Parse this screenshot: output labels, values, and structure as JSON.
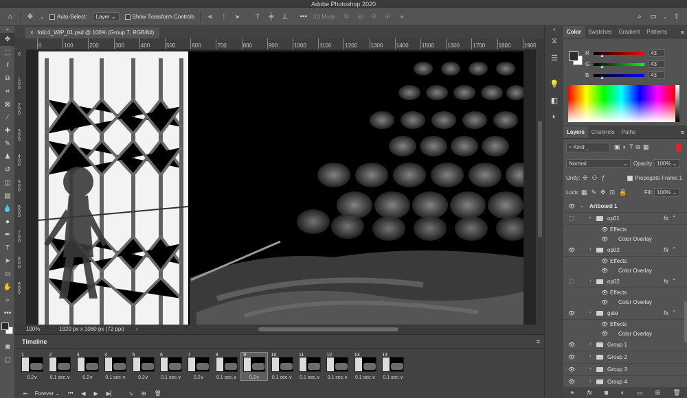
{
  "app": {
    "title": "Adobe Photoshop 2020"
  },
  "options_bar": {
    "auto_select_label": "Auto-Select:",
    "auto_select_checked": false,
    "auto_select_target": "Layer",
    "show_transform_label": "Show Transform Controls",
    "mode_3d_label": "3D Mode:"
  },
  "document": {
    "tab_title": "folio1_WIP_01.psd @ 100% (Group 7, RGB/8#)",
    "zoom": "100%",
    "doc_info": "1920 px x 1080 px (72 ppi)"
  },
  "ruler": {
    "h_ticks": [
      "0",
      "100",
      "200",
      "300",
      "400",
      "500",
      "600",
      "700",
      "800",
      "900",
      "1000",
      "1100",
      "1200",
      "1300",
      "1400",
      "1500",
      "1600",
      "1700",
      "1800",
      "1900"
    ],
    "v_ticks": [
      "0",
      "1\n0\n0",
      "2\n0\n0",
      "3\n0\n0",
      "4\n0\n0",
      "5\n0\n0",
      "6\n0\n0",
      "7\n0\n0",
      "8\n0\n0",
      "9\n0\n0"
    ]
  },
  "timeline": {
    "title": "Timeline",
    "loop": "Forever",
    "frames": [
      {
        "num": "1",
        "delay": "0.2∨"
      },
      {
        "num": "2",
        "delay": "0.1 sec.∨"
      },
      {
        "num": "3",
        "delay": "0.2∨"
      },
      {
        "num": "4",
        "delay": "0.1 sec.∨"
      },
      {
        "num": "5",
        "delay": "0.2∨"
      },
      {
        "num": "6",
        "delay": "0.1 sec.∨"
      },
      {
        "num": "7",
        "delay": "0.2∨"
      },
      {
        "num": "8",
        "delay": "0.1 sec.∨"
      },
      {
        "num": "9",
        "delay": "0.2∨"
      },
      {
        "num": "10",
        "delay": "0.1 sec.∨"
      },
      {
        "num": "11",
        "delay": "0.1 sec.∨"
      },
      {
        "num": "12",
        "delay": "0.1 sec.∨"
      },
      {
        "num": "13",
        "delay": "0.1 sec.∨"
      },
      {
        "num": "14",
        "delay": "0.1 sec.∨"
      }
    ],
    "selected_frame": "9"
  },
  "color_panel": {
    "tabs": [
      "Color",
      "Swatches",
      "Gradient",
      "Patterns"
    ],
    "active_tab": "Color",
    "r_label": "R",
    "g_label": "G",
    "b_label": "B",
    "r": "43",
    "g": "43",
    "b": "43",
    "foreground_color": "#2b2b2b",
    "background_color": "#ffffff"
  },
  "layers_panel": {
    "tabs": [
      "Layers",
      "Channels",
      "Paths"
    ],
    "active_tab": "Layers",
    "filter_kind": "Kind",
    "blend_mode": "Normal",
    "opacity_label": "Opacity:",
    "opacity": "100%",
    "unify_label": "Unify:",
    "propagate_label": "Propagate Frame 1",
    "propagate_checked": true,
    "lock_label": "Lock:",
    "fill_label": "Fill:",
    "fill": "100%",
    "artboard": "Artboard 1",
    "effects_label": "Effects",
    "color_overlay_label": "Color Overlay",
    "fx_label": "fx",
    "layers": [
      {
        "name": "op01",
        "visible": false,
        "has_effects": true
      },
      {
        "name": "op02",
        "visible": true,
        "has_effects": true
      },
      {
        "name": "op02",
        "visible": false,
        "has_effects": true
      },
      {
        "name": "gate",
        "visible": true,
        "has_effects": true
      },
      {
        "name": "Group 1",
        "visible": true,
        "has_effects": false
      },
      {
        "name": "Group 2",
        "visible": true,
        "has_effects": false
      },
      {
        "name": "Group 3",
        "visible": true,
        "has_effects": false
      },
      {
        "name": "Group 4",
        "visible": true,
        "has_effects": false
      }
    ]
  }
}
